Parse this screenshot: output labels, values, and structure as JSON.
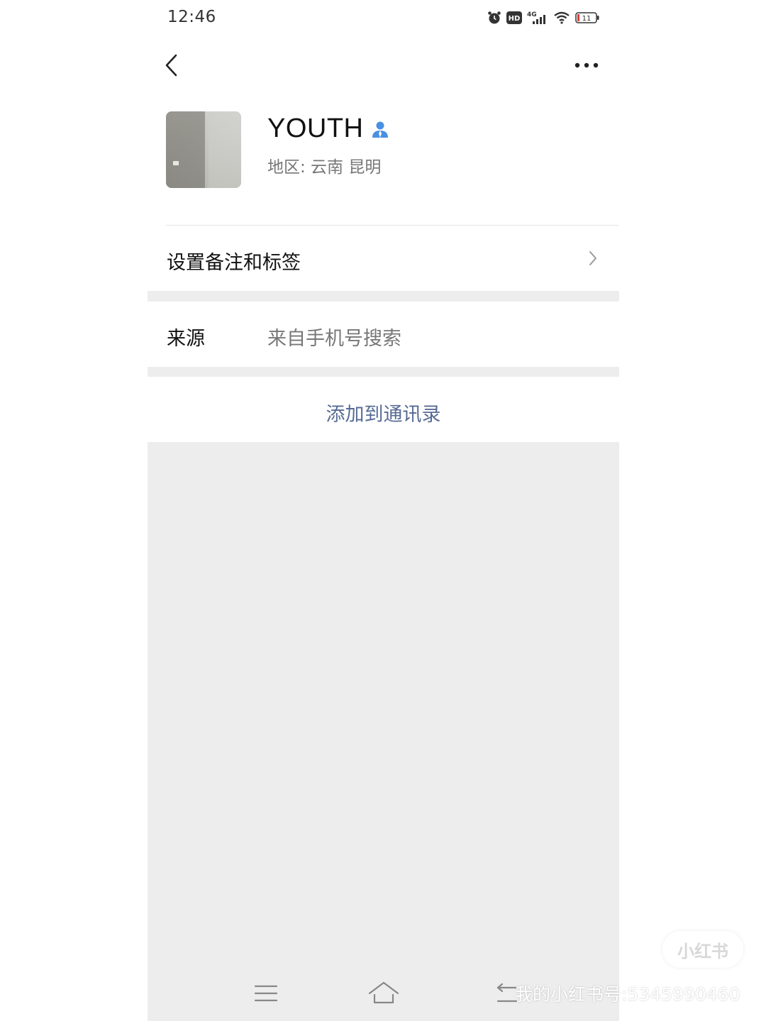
{
  "status_bar": {
    "time": "12:46",
    "network": "4G",
    "hd_label": "HD",
    "battery": "11"
  },
  "icons": {
    "back": "chevron-left-icon",
    "more": "more-dots-icon",
    "verified": "person-icon",
    "chevron": "chevron-right-icon"
  },
  "profile": {
    "name": "YOUTH",
    "region": "地区:  云南   昆明"
  },
  "rows": {
    "remark_label": "设置备注和标签",
    "source_label": "来源",
    "source_value": "来自手机号搜索",
    "add_contact": "添加到通讯录"
  },
  "watermark": {
    "logo_text": "小红书",
    "text": "我的小红书号:5345990460"
  },
  "colors": {
    "link": "#576b95",
    "page_bg": "#ededed",
    "verified_icon": "#4a90e2"
  }
}
